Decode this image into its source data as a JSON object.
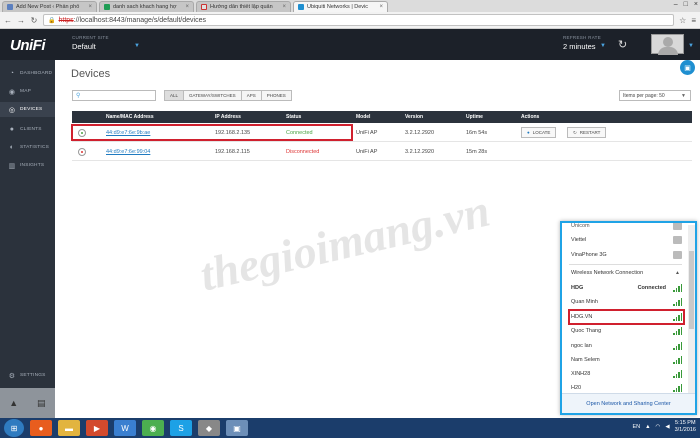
{
  "browser": {
    "tabs": [
      {
        "label": "Add New Post ‹ Phần phố",
        "color": "#5b7fbf",
        "active": false
      },
      {
        "label": "danh sach khach hang hợ",
        "color": "#1f9d55",
        "active": false
      },
      {
        "label": "Hướng dẫn thiết lập quản",
        "color": "#e0e0e0",
        "active": false
      },
      {
        "label": "Ubiquiti Networks | Devic",
        "color": "#1f8fd0",
        "active": true
      }
    ],
    "url_scheme": "https",
    "url_rest": "://localhost:8443/manage/s/default/devices"
  },
  "header": {
    "logo": "UniFi",
    "current_site_label": "CURRENT SITE",
    "current_site_value": "Default",
    "refresh_label": "REFRESH RATE",
    "refresh_value": "2 minutes"
  },
  "sidebar": {
    "items": [
      {
        "label": "DASHBOARD",
        "icon": "dashboard-icon"
      },
      {
        "label": "MAP",
        "icon": "map-icon"
      },
      {
        "label": "DEVICES",
        "icon": "devices-icon"
      },
      {
        "label": "CLIENTS",
        "icon": "clients-icon"
      },
      {
        "label": "STATISTICS",
        "icon": "statistics-icon"
      },
      {
        "label": "INSIGHTS",
        "icon": "insights-icon"
      }
    ],
    "settings_label": "SETTINGS"
  },
  "main": {
    "title": "Devices",
    "filters": [
      "ALL",
      "GATEWAY/SWITCHES",
      "APS",
      "PHONES"
    ],
    "per_page": "Items per page: 50",
    "columns": [
      "Name/MAC Address",
      "IP Address",
      "Status",
      "Model",
      "Version",
      "Uptime",
      "Actions"
    ],
    "rows": [
      {
        "mac": "44:d9:e7:6e:9b:ae",
        "ip": "192.168.2.135",
        "status": "Connected",
        "model": "UniFi AP",
        "version": "3.2.12.2920",
        "uptime": "16m 54s",
        "locate": "LOCATE",
        "restart": "RESTART"
      },
      {
        "mac": "44:d9:e7:6e:99:04",
        "ip": "192.168.2.115",
        "status": "Disconnected",
        "model": "UniFi AP",
        "version": "3.2.12.2920",
        "uptime": "15m 28s"
      }
    ]
  },
  "watermark": "thegioimang.vn",
  "network_flyout": {
    "top_items": [
      "Viettel",
      "VinaPhone 3G"
    ],
    "section": "Wireless Network Connection",
    "connected_name": "HDG",
    "connected_status": "Connected",
    "networks": [
      "Quan Minh",
      "HDG.VN",
      "Quoc Thang",
      "ngoc lan",
      "Nam Selem",
      "XINH28",
      "H20"
    ],
    "footer": "Open Network and Sharing Center"
  },
  "taskbar": {
    "lang": "EN",
    "time": "5:15 PM",
    "date": "3/1/2016"
  }
}
